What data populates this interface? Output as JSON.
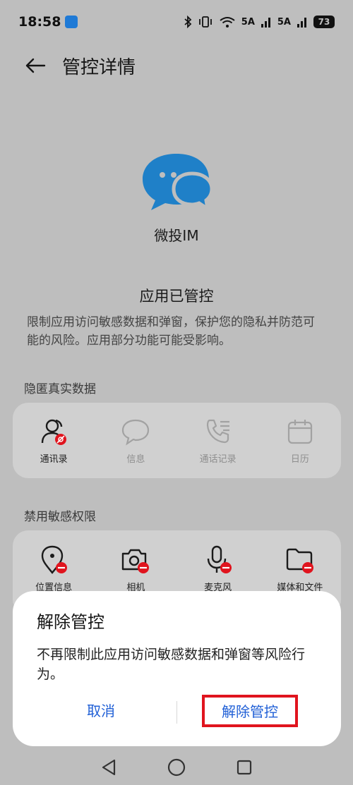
{
  "status_bar": {
    "time": "18:58",
    "network_label": "5A",
    "battery": "73"
  },
  "header": {
    "title": "管控详情"
  },
  "app": {
    "name": "微投IM",
    "brand_color": "#1f80c8"
  },
  "status": {
    "heading": "应用已管控",
    "description": "限制应用访问敏感数据和弹窗，保护您的隐私并防范可能的风险。应用部分功能可能受影响。"
  },
  "hidden_data": {
    "label": "隐匿真实数据",
    "items": [
      {
        "label": "通讯录",
        "icon": "contacts-icon",
        "active": true
      },
      {
        "label": "信息",
        "icon": "message-icon",
        "active": false
      },
      {
        "label": "通话记录",
        "icon": "call-log-icon",
        "active": false
      },
      {
        "label": "日历",
        "icon": "calendar-icon",
        "active": false
      }
    ]
  },
  "disabled_permissions": {
    "label": "禁用敏感权限",
    "items": [
      {
        "label": "位置信息",
        "icon": "location-icon"
      },
      {
        "label": "相机",
        "icon": "camera-icon"
      },
      {
        "label": "麦克风",
        "icon": "microphone-icon"
      },
      {
        "label": "媒体和文件",
        "icon": "folder-icon"
      }
    ]
  },
  "dialog": {
    "title": "解除管控",
    "message": "不再限制此应用访问敏感数据和弹窗等风险行为。",
    "cancel_label": "取消",
    "confirm_label": "解除管控",
    "highlight_color": "#e0141e",
    "button_color": "#1f5fd6"
  },
  "colors": {
    "block_badge": "#e0141e"
  }
}
